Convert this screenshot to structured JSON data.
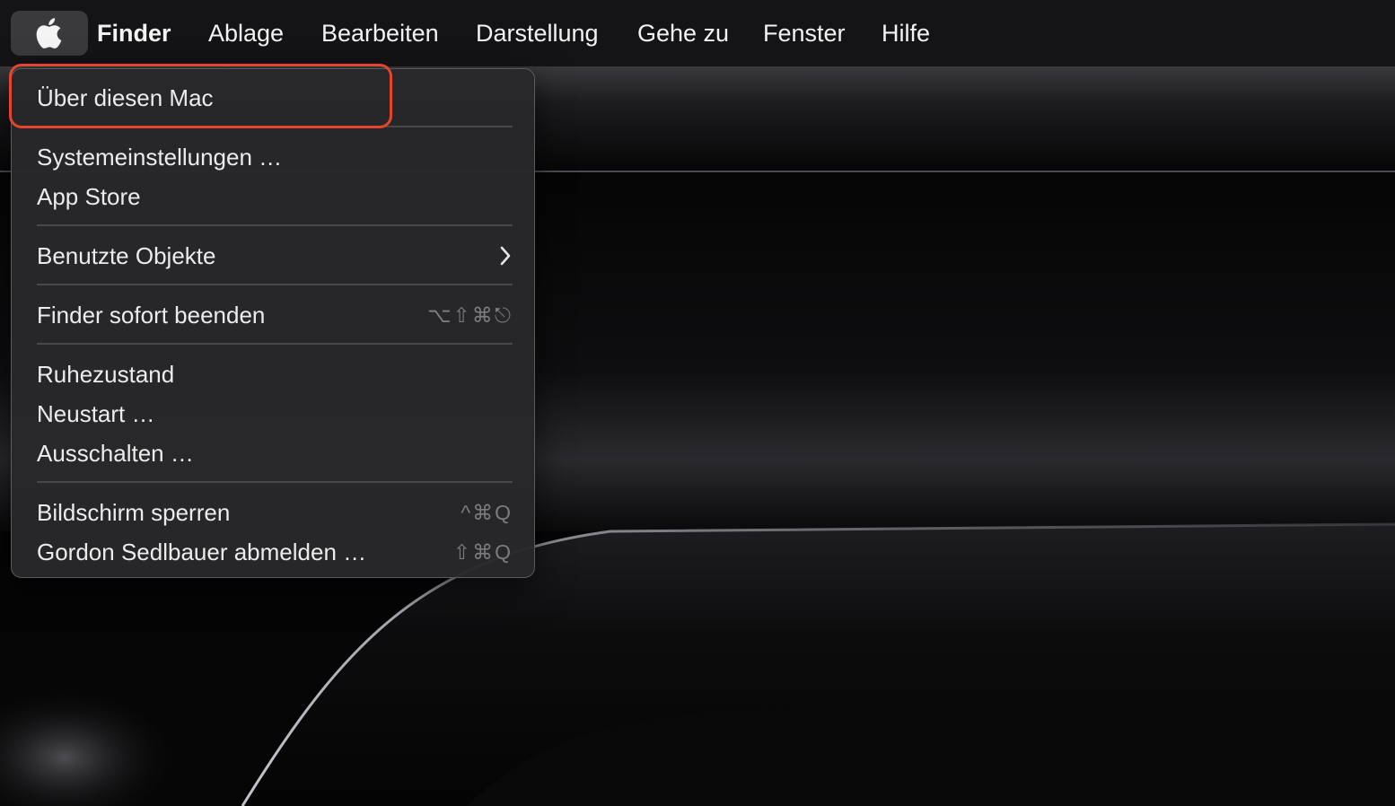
{
  "menubar": {
    "apple_icon": "apple-logo-icon",
    "app_name": "Finder",
    "menus": [
      "Ablage",
      "Bearbeiten",
      "Darstellung",
      "Gehe zu",
      "Fenster",
      "Hilfe"
    ]
  },
  "apple_menu": {
    "items": {
      "about": "Über diesen Mac",
      "system_settings": "Systemeinstellungen …",
      "app_store": "App Store",
      "recent_items": "Benutzte Objekte",
      "force_quit": "Finder sofort beenden",
      "force_quit_shortcut": "⌥⇧⌘⎋",
      "sleep": "Ruhezustand",
      "restart": "Neustart …",
      "shut_down": "Ausschalten …",
      "lock_screen": "Bildschirm sperren",
      "lock_screen_shortcut": "^⌘Q",
      "log_out": "Gordon Sedlbauer abmelden …",
      "log_out_shortcut": "⇧⌘Q"
    },
    "submenu_icon": "chevron-right-icon"
  },
  "annotation": {
    "highlight_color": "#e5442f",
    "highlighted_item": "Über diesen Mac"
  },
  "colors": {
    "menubar_bg": "#141416",
    "menu_bg": "#28282a",
    "menu_text": "#ececec",
    "shortcut_text": "#7c7c80",
    "apple_button_bg": "#3a3a3c"
  }
}
